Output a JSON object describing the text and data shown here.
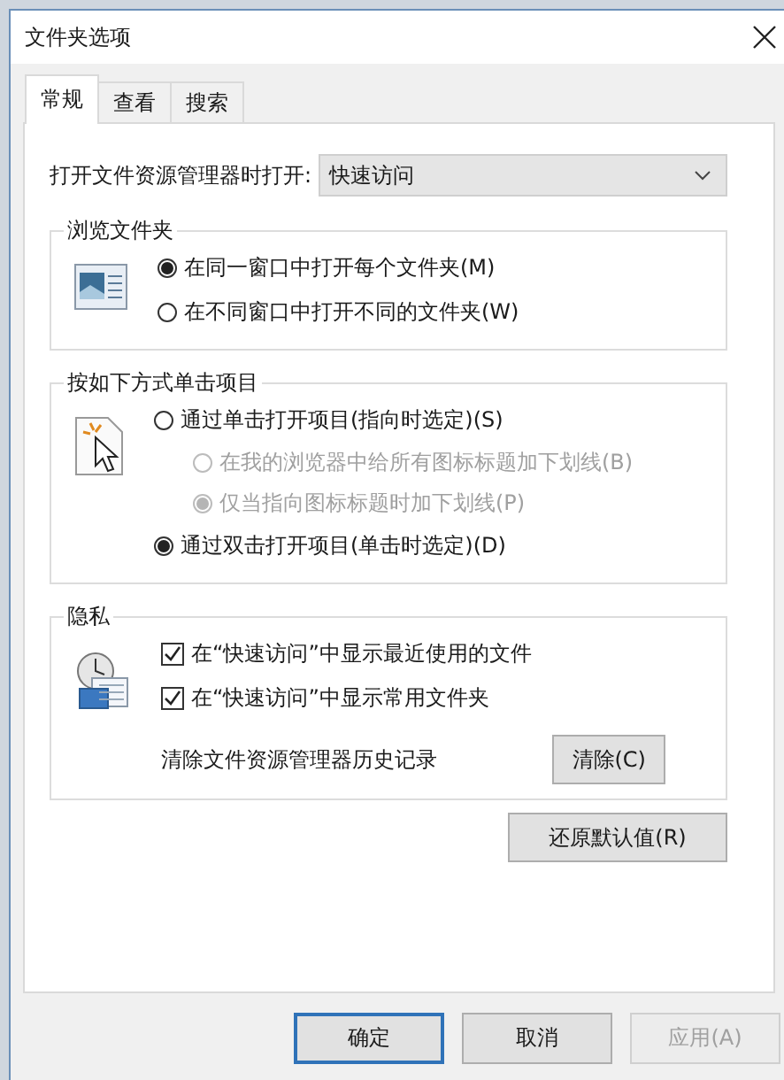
{
  "window": {
    "title": "文件夹选项"
  },
  "tabs": [
    {
      "label": "常规",
      "selected": true
    },
    {
      "label": "查看",
      "selected": false
    },
    {
      "label": "搜索",
      "selected": false
    }
  ],
  "open_with": {
    "label": "打开文件资源管理器时打开:",
    "value": "快速访问"
  },
  "groups": [
    {
      "title": "浏览文件夹",
      "kind": "radio",
      "options": [
        {
          "label": "在同一窗口中打开每个文件夹(M)",
          "selected": true,
          "disabled": false
        },
        {
          "label": "在不同窗口中打开不同的文件夹(W)",
          "selected": false,
          "disabled": false
        }
      ]
    },
    {
      "title": "按如下方式单击项目",
      "kind": "radio",
      "options": [
        {
          "label": "通过单击打开项目(指向时选定)(S)",
          "selected": false,
          "disabled": false,
          "children": [
            {
              "label": "在我的浏览器中给所有图标标题加下划线(B)",
              "selected": false,
              "disabled": true
            },
            {
              "label": "仅当指向图标标题时加下划线(P)",
              "selected": true,
              "disabled": true
            }
          ]
        },
        {
          "label": "通过双击打开项目(单击时选定)(D)",
          "selected": true,
          "disabled": false
        }
      ]
    },
    {
      "title": "隐私",
      "kind": "checkbox",
      "options": [
        {
          "label": "在“快速访问”中显示最近使用的文件",
          "checked": true
        },
        {
          "label": "在“快速访问”中显示常用文件夹",
          "checked": true
        }
      ],
      "clear_row": {
        "label": "清除文件资源管理器历史记录",
        "button": "清除(C)"
      }
    }
  ],
  "restore_button": "还原默认值(R)",
  "footer_buttons": [
    {
      "label": "确定",
      "default": true,
      "disabled": false
    },
    {
      "label": "取消",
      "default": false,
      "disabled": false
    },
    {
      "label": "应用(A)",
      "default": false,
      "disabled": true
    }
  ]
}
